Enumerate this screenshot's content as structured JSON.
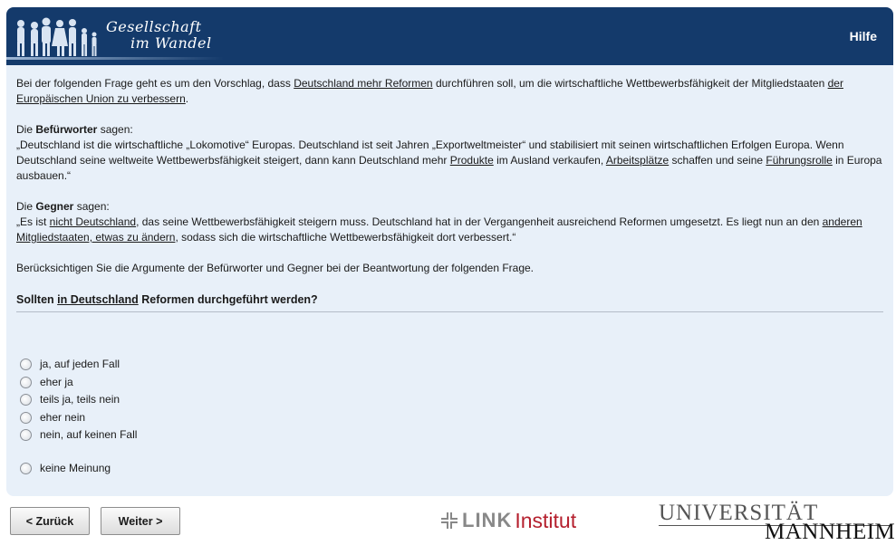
{
  "header": {
    "logo_line1": "Gesellschaft",
    "logo_line2": "im Wandel",
    "help_label": "Hilfe"
  },
  "intro": {
    "t1": "Bei der folgenden Frage geht es um den Vorschlag, dass ",
    "u1": "Deutschland mehr Reformen",
    "t2": " durchführen soll, um die wirtschaftliche Wettbewerbsfähigkeit der Mitgliedstaaten ",
    "u2": "der Europäischen Union zu verbessern",
    "t3": "."
  },
  "pro": {
    "prefix": "Die ",
    "bold": "Befürworter",
    "suffix": " sagen:",
    "t1": "„Deutschland ist die wirtschaftliche „Lokomotive“ Europas. Deutschland ist seit Jahren „Exportweltmeister“ und stabilisiert mit seinen wirtschaftlichen Erfolgen Europa. Wenn Deutschland seine weltweite Wettbewerbsfähigkeit steigert, dann kann Deutschland mehr ",
    "u1": "Produkte",
    "t2": " im Ausland verkaufen, ",
    "u2": "Arbeitsplätze",
    "t3": " schaffen und seine ",
    "u3": "Führungsrolle",
    "t4": " in Europa ausbauen.“"
  },
  "contra": {
    "prefix": "Die ",
    "bold": "Gegner",
    "suffix": " sagen:",
    "t1": "„Es ist ",
    "u1": "nicht Deutschland",
    "t2": ", das seine Wettbewerbsfähigkeit steigern muss. Deutschland hat in der Vergangenheit ausreichend Reformen umgesetzt. Es liegt nun an den ",
    "u2": "anderen Mitgliedstaaten, etwas zu ändern",
    "t3": ", sodass sich die wirtschaftliche Wettbewerbsfähigkeit dort verbessert.“"
  },
  "instruction": "Berücksichtigen Sie die Argumente der Befürworter und Gegner bei der Beantwortung der folgenden Frage.",
  "question": {
    "t1": "Sollten ",
    "u1": "in Deutschland",
    "t2": " Reformen durchgeführt werden?"
  },
  "options": [
    "ja, auf jeden Fall",
    "eher ja",
    "teils ja, teils nein",
    "eher nein",
    "nein, auf keinen Fall",
    "keine Meinung"
  ],
  "nav": {
    "back": "< Zurück",
    "next": "Weiter >"
  },
  "logos": {
    "link_bold": "LINK",
    "link_institut": "Institut",
    "uni_line1": "UNIVERSITÄT",
    "uni_line2": "MANNHEIM"
  }
}
